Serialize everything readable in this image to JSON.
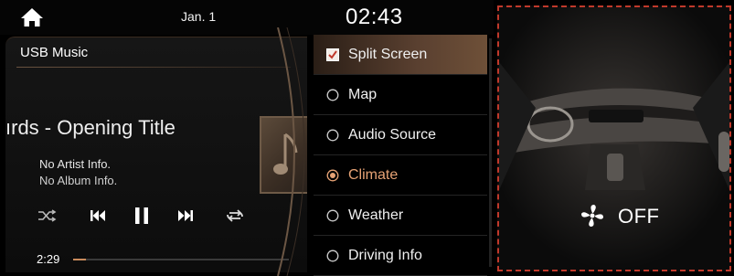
{
  "status_bar": {
    "date": "Jan. 1",
    "time": "02:43"
  },
  "music": {
    "source_title": "USB Music",
    "song_title": "ırds - Opening Title",
    "artist": "No Artist Info.",
    "album": "No Album Info.",
    "elapsed": "2:29",
    "progress_fraction": 0.06
  },
  "menu": {
    "items": [
      {
        "label": "Split Screen",
        "control": "checkbox",
        "checked": true
      },
      {
        "label": "Map",
        "control": "radio",
        "checked": false
      },
      {
        "label": "Audio Source",
        "control": "radio",
        "checked": false
      },
      {
        "label": "Climate",
        "control": "radio",
        "checked": true
      },
      {
        "label": "Weather",
        "control": "radio",
        "checked": false
      },
      {
        "label": "Driving Info",
        "control": "radio",
        "checked": false
      }
    ]
  },
  "climate": {
    "fan_status": "OFF"
  },
  "colors": {
    "accent": "#e7a375",
    "highlight_border": "#c0392b",
    "progress": "#c98a5c"
  },
  "icons": [
    "home-icon",
    "shuffle-icon",
    "previous-icon",
    "pause-icon",
    "next-icon",
    "repeat-icon",
    "music-note-icon",
    "fan-icon"
  ]
}
